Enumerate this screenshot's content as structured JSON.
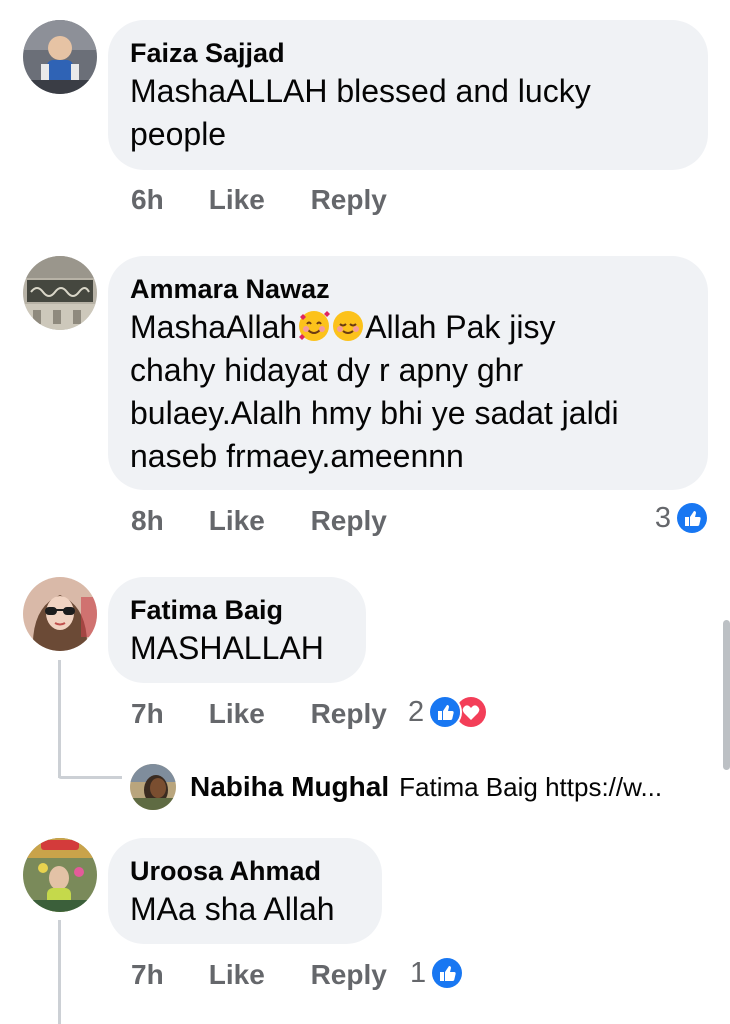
{
  "comments": [
    {
      "author": "Faiza Sajjad",
      "text": "MashaALLAH blessed and lucky people",
      "text_lines": [
        "MashaALLAH blessed and lucky",
        "people"
      ],
      "time": "6h",
      "like_label": "Like",
      "reply_label": "Reply"
    },
    {
      "author": "Ammara Nawaz",
      "text_part1": "MashaAllah",
      "emoji1": "smiling-face-with-hearts-emoji",
      "emoji2": "relieved-face-emoji",
      "text_lines": [
        "Allah Pak jisy",
        "chahy hidayat dy r apny ghr",
        "bulaey.Alalh hmy bhi ye sadat jaldi",
        "naseb frmaey.ameennn"
      ],
      "time": "8h",
      "like_label": "Like",
      "reply_label": "Reply",
      "reaction_count": "3",
      "reaction_icons": [
        "like-icon"
      ]
    },
    {
      "author": "Fatima Baig",
      "text": "MASHALLAH",
      "time": "7h",
      "like_label": "Like",
      "reply_label": "Reply",
      "reaction_count": "2",
      "reaction_icons": [
        "like-icon",
        "love-icon"
      ],
      "reply_preview": {
        "author": "Nabiha Mughal",
        "text": "Fatima Baig https://w..."
      }
    },
    {
      "author": "Uroosa Ahmad",
      "text": "MAa sha Allah",
      "time": "7h",
      "like_label": "Like",
      "reply_label": "Reply",
      "reaction_count": "1",
      "reaction_icons": [
        "like-icon"
      ]
    }
  ],
  "colors": {
    "bubble": "#f0f2f5",
    "meta_text": "#65676b",
    "like_blue": "#1877f2",
    "love_red": "#f33e58",
    "thread_line": "#ccd0d5"
  }
}
